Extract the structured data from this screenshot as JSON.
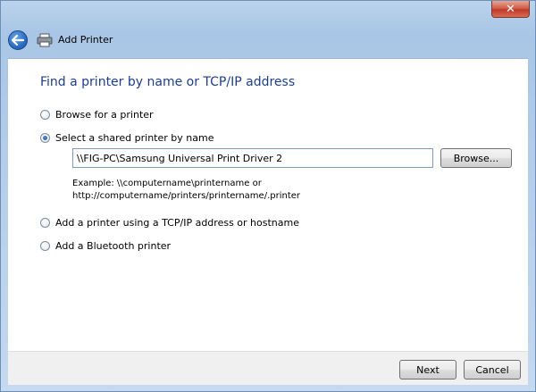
{
  "window": {
    "title": "Add Printer",
    "close_label": "✕"
  },
  "heading": "Find a printer by name or TCP/IP address",
  "options": [
    {
      "label": "Browse for a printer",
      "selected": false
    },
    {
      "label": "Select a shared printer by name",
      "selected": true
    },
    {
      "label": "Add a printer using a TCP/IP address or hostname",
      "selected": false
    },
    {
      "label": "Add a Bluetooth printer",
      "selected": false
    }
  ],
  "printer_name": {
    "value": "\\\\FIG-PC\\Samsung Universal Print Driver 2"
  },
  "browse_label": "Browse...",
  "example": {
    "line1": "Example: \\\\computername\\printername or",
    "line2": "http://computername/printers/printername/.printer"
  },
  "footer": {
    "next_label": "Next",
    "cancel_label": "Cancel"
  }
}
